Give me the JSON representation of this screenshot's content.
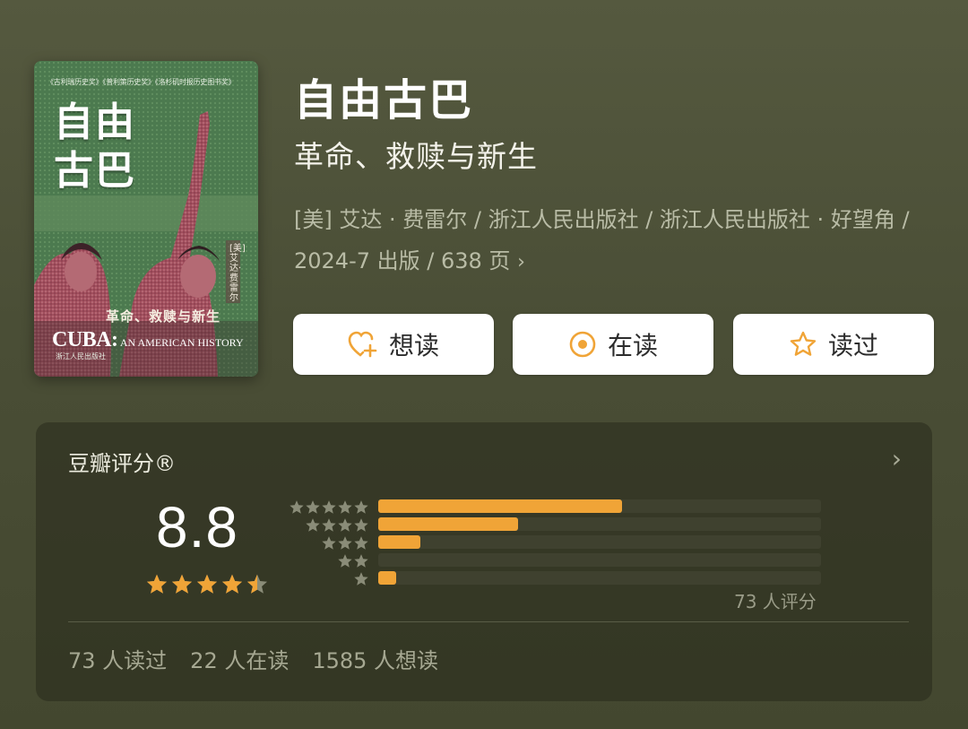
{
  "cover": {
    "series": "《古利瑞历史奖》《普利策历史奖》《洛杉矶时报历史图书奖》",
    "title_line1": "自由",
    "title_line2": "古巴",
    "subtitle": "革命、救赎与新生",
    "english_big": "CUBA:",
    "english_rest": " AN AMERICAN HISTORY",
    "author": "[美] 艾达·费雷尔",
    "publisher": "浙江人民出版社"
  },
  "book": {
    "title": "自由古巴",
    "subtitle": "革命、救赎与新生",
    "meta": "[美] 艾达 · 费雷尔 / 浙江人民出版社 / 浙江人民出版社 · 好望角 / 2024-7 出版 / 638 页",
    "meta_arrow": "›"
  },
  "actions": {
    "want": "想读",
    "reading": "在读",
    "read": "读过"
  },
  "rating": {
    "title": "豆瓣评分®",
    "chevron": "›",
    "score": "8.8",
    "stars_value": 4.5,
    "distribution": [
      {
        "stars": 5,
        "fraction": 0.55
      },
      {
        "stars": 4,
        "fraction": 0.315
      },
      {
        "stars": 3,
        "fraction": 0.095
      },
      {
        "stars": 2,
        "fraction": 0.0
      },
      {
        "stars": 1,
        "fraction": 0.04
      }
    ],
    "count": "73 人评分"
  },
  "stats": {
    "read": "73 人读过",
    "reading": "22 人在读",
    "want": "1585 人想读"
  },
  "colors": {
    "accent": "#f0a437",
    "background": "#4d5138",
    "panel": "#2f3122"
  }
}
